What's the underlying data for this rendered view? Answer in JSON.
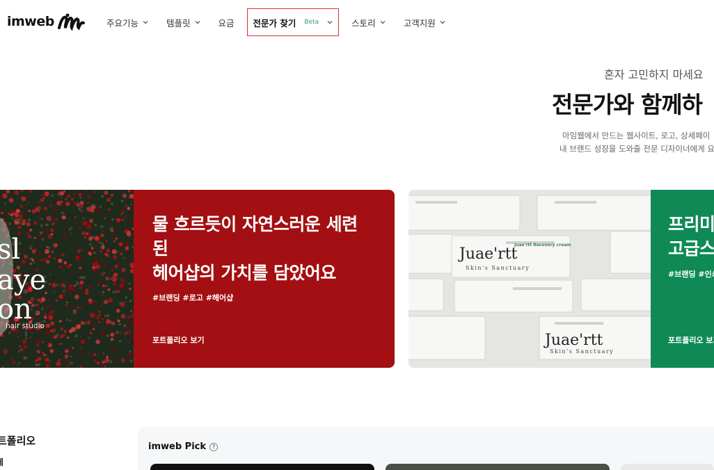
{
  "header": {
    "logo_text": "imweb",
    "nav": [
      {
        "label": "주요기능"
      },
      {
        "label": "템플릿"
      },
      {
        "label": "요금"
      },
      {
        "label": "전문가 찾기",
        "badge": "Beta"
      },
      {
        "label": "스토리"
      },
      {
        "label": "고객지원"
      }
    ]
  },
  "hero": {
    "subtitle": "혼자 고민하지 마세요",
    "title": "전문가와 함께하",
    "desc_line1": "아임웹에서 만드는 웹사이트, 로고, 상세페이",
    "desc_line2": "내 브랜드 성장을 도와줄 전문 디자이너에게 요"
  },
  "cards": [
    {
      "image_text": [
        "sl",
        "aye",
        "on"
      ],
      "image_caption": "hair studio",
      "title_line1": "물 흐르듯이 자연스러운 세련",
      "title_line2": "된",
      "title_line3": "헤어샵의 가치를 담았어요",
      "tags": "#브랜딩 #로고 #헤어샵",
      "link": "포트폴리오 보기"
    },
    {
      "brand_text": "Juae'rtt",
      "brand_sub": "Skin's Sanctuary",
      "product_label": "Juae'rtt Recovery cream",
      "title_line1": "프리미",
      "title_line2": "고급스",
      "tags": "#브랜딩 #인쇄",
      "link": "포트폴리오 보기"
    }
  ],
  "portfolio": {
    "title": "트폴리오",
    "filter_all": "체",
    "pick_title": "imweb Pick",
    "help_glyph": "?"
  },
  "colors": {
    "card1_bg": "#a30f12",
    "card2_bg": "#0f8a57",
    "active_border": "#d9303a",
    "beta": "#2e9b6a"
  }
}
